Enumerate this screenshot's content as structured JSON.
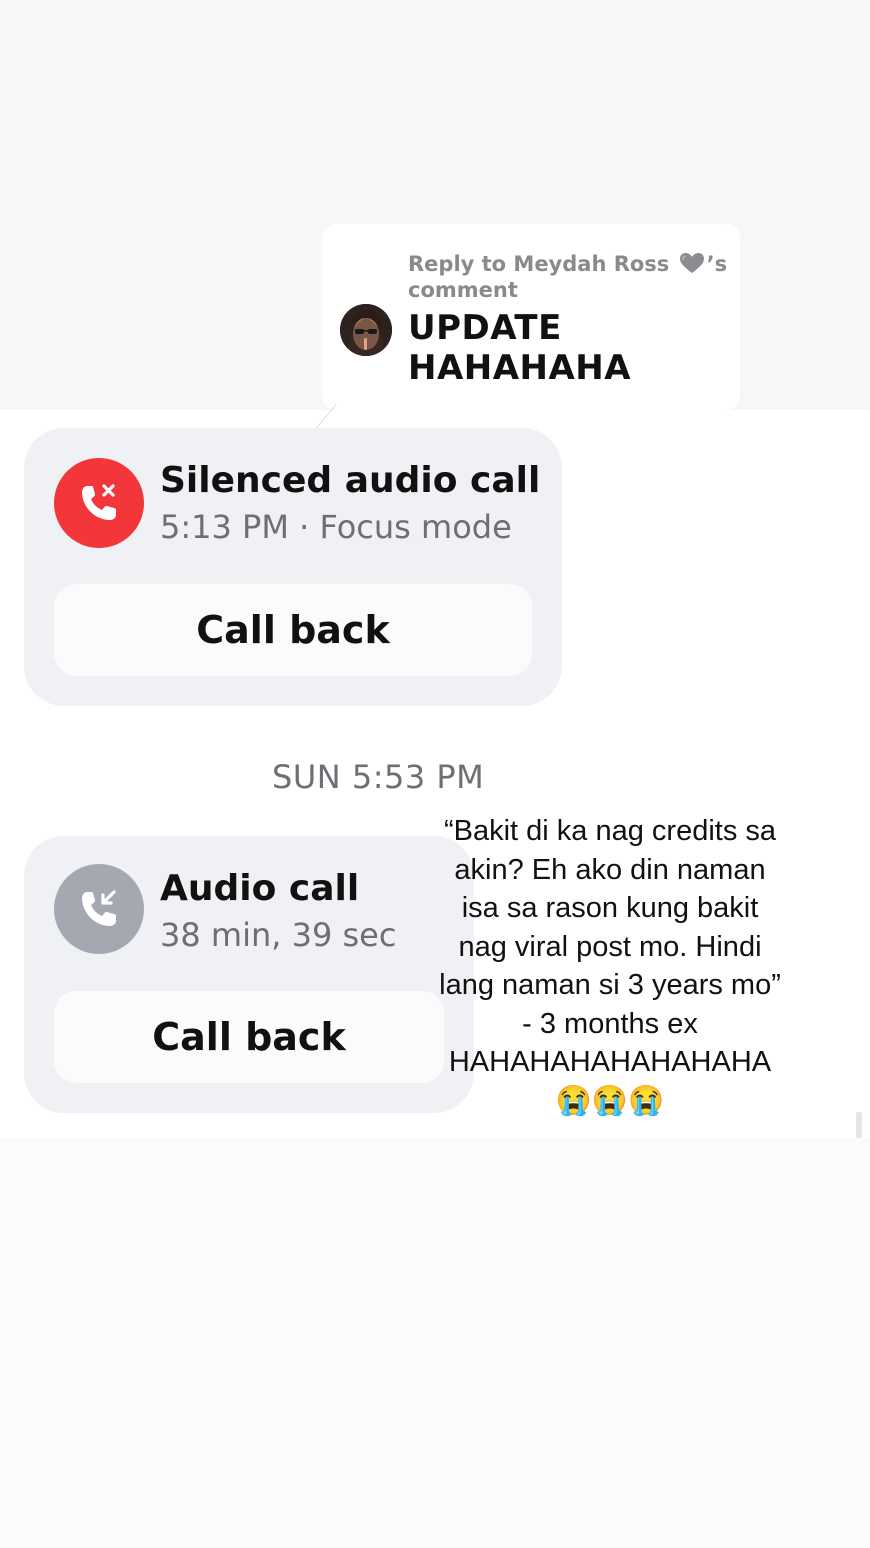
{
  "reply": {
    "header_prefix": "Reply to Meydah Ross",
    "header_suffix": "’s",
    "header_line2": "comment",
    "text_line1": "UPDATE",
    "text_line2": "HAHAHAHA"
  },
  "calls": [
    {
      "title": "Silenced audio call",
      "subtitle": "5:13 PM · Focus mode",
      "button_label": "Call back",
      "icon": "phone-missed-icon",
      "icon_color": "#f2363a"
    },
    {
      "title": "Audio call",
      "subtitle": "38 min, 39 sec",
      "button_label": "Call back",
      "icon": "phone-incoming-icon",
      "icon_color": "#a5a8b1"
    }
  ],
  "timestamp": "SUN 5:53 PM",
  "caption": {
    "lines": [
      "“Bakit di ka nag credits sa",
      "akin? Eh ako din naman",
      "isa sa rason kung bakit",
      "nag viral post mo. Hindi",
      "lang naman si 3 years mo”",
      "- 3 months ex",
      "HAHAHAHAHAHAHAHA",
      "😭😭😭"
    ]
  }
}
